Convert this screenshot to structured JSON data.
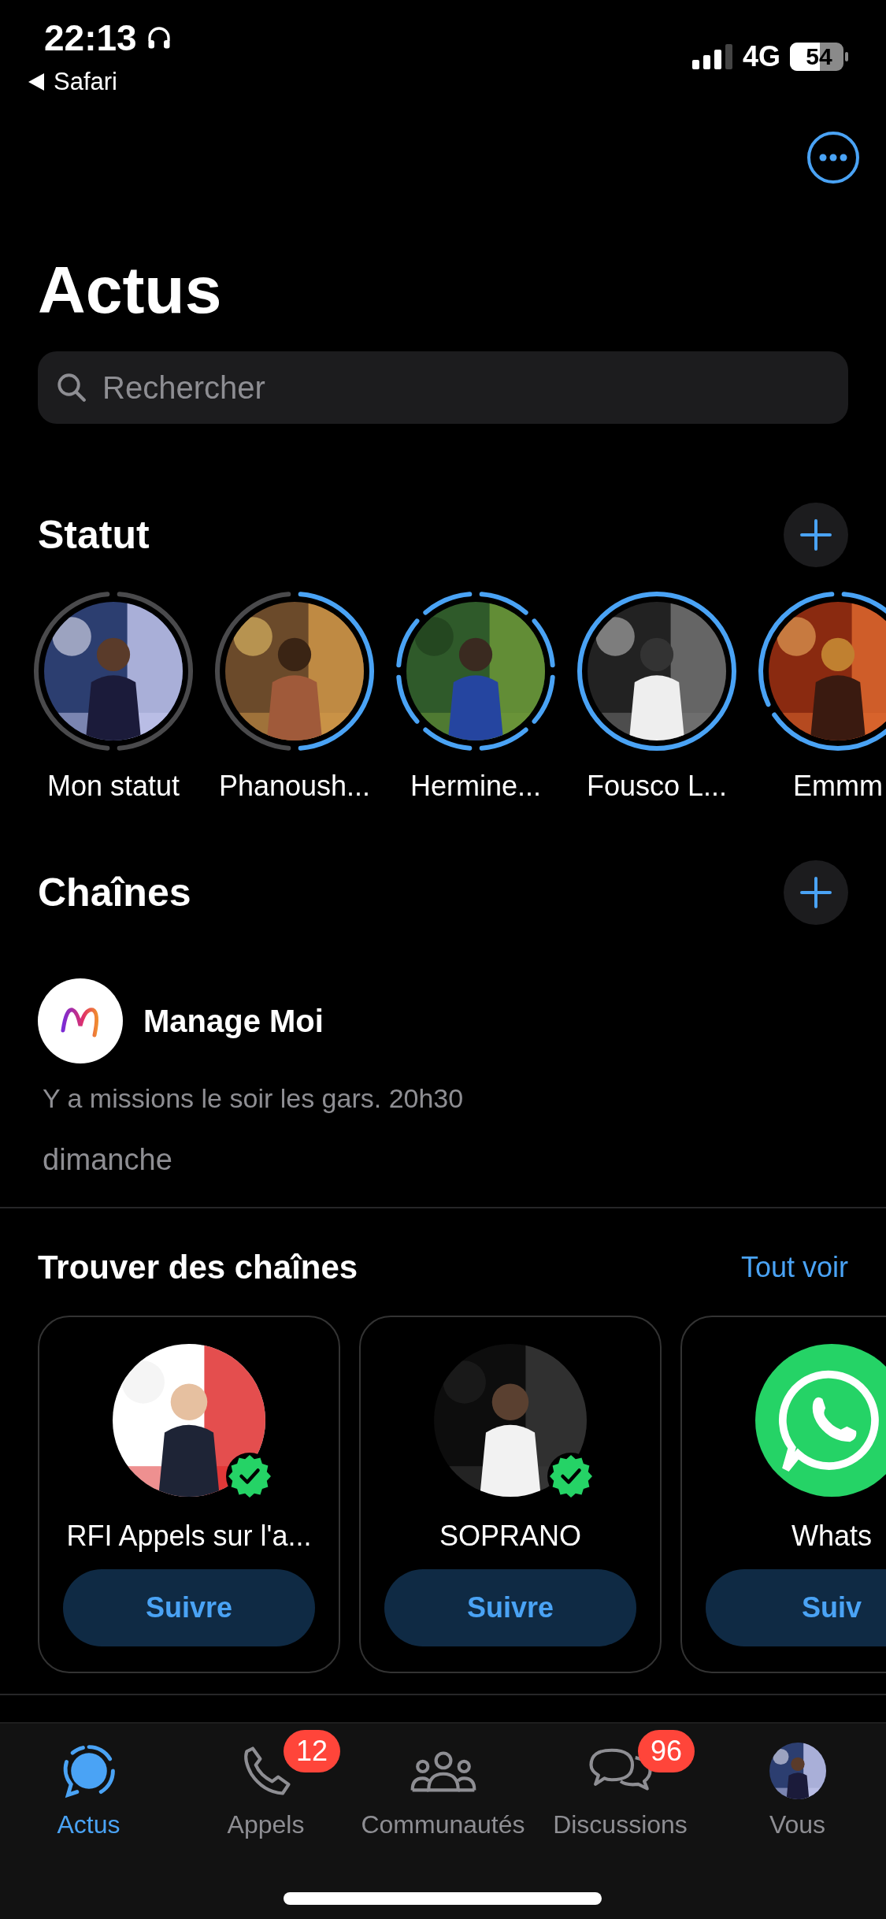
{
  "status_bar": {
    "time": "22:13",
    "back_label": "Safari",
    "network": "4G",
    "battery": "54"
  },
  "header": {
    "title": "Actus",
    "search": {
      "placeholder": "Rechercher"
    }
  },
  "status_section": {
    "title": "Statut",
    "items": [
      {
        "name": "Mon statut",
        "updates": [
          {
            "seen": true
          },
          {
            "seen": true
          }
        ]
      },
      {
        "name": "Phanoush...",
        "updates": [
          {
            "seen": false
          },
          {
            "seen": true
          }
        ]
      },
      {
        "name": "Hermine...",
        "updates": [
          {
            "seen": false
          },
          {
            "seen": false
          },
          {
            "seen": false
          },
          {
            "seen": false
          },
          {
            "seen": false
          },
          {
            "seen": false
          },
          {
            "seen": false
          },
          {
            "seen": false
          }
        ]
      },
      {
        "name": "Fousco L...",
        "updates": [
          {
            "seen": false
          }
        ]
      },
      {
        "name": "Emmm",
        "updates": [
          {
            "seen": false
          },
          {
            "seen": false
          },
          {
            "seen": false
          }
        ]
      }
    ]
  },
  "channels_section": {
    "title": "Chaînes",
    "items": [
      {
        "name": "Manage Moi",
        "message": "Y a missions le soir les gars. 20h30",
        "time": "dimanche"
      }
    ]
  },
  "find_channels": {
    "title": "Trouver des chaînes",
    "link": "Tout voir",
    "cards": [
      {
        "name": "RFI Appels sur l'a...",
        "kind": "picture",
        "verified": true,
        "button": "Suivre"
      },
      {
        "name": "SOPRANO",
        "kind": "picture",
        "verified": true,
        "button": "Suivre"
      },
      {
        "name": "Whats",
        "kind": "logo",
        "button": "Suiv"
      }
    ]
  },
  "tabs": [
    {
      "label": "Actus",
      "kind": "status",
      "selected": true
    },
    {
      "label": "Appels",
      "kind": "phone",
      "selected": false,
      "badge": "12"
    },
    {
      "label": "Communautés",
      "kind": "people",
      "selected": false
    },
    {
      "label": "Discussions",
      "kind": "chats",
      "selected": false,
      "badge": "96"
    },
    {
      "label": "Vous",
      "kind": "avatar",
      "selected": false
    }
  ]
}
